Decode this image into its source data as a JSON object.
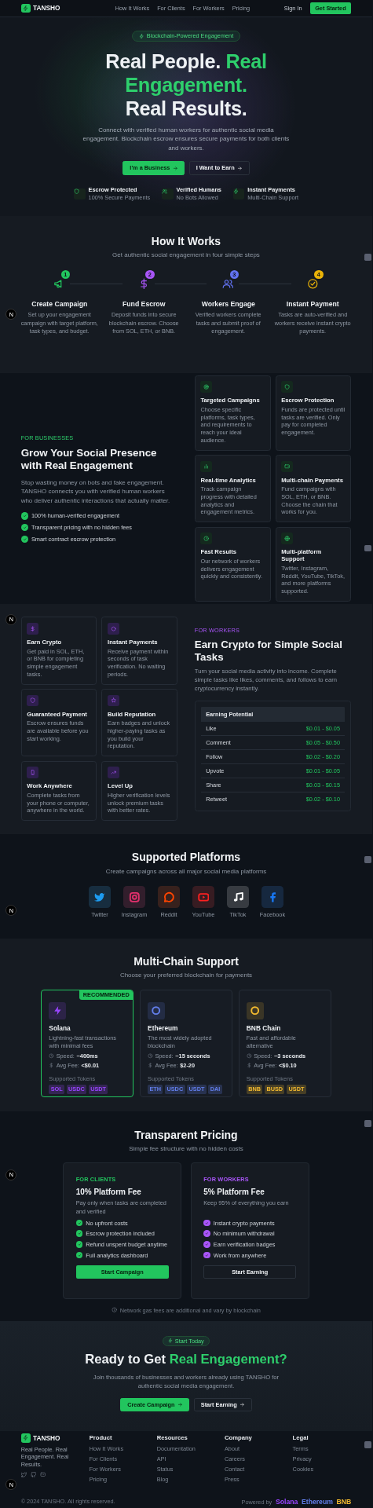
{
  "nav": {
    "logo": "TANSHO",
    "links": [
      "How It Works",
      "For Clients",
      "For Workers",
      "Pricing"
    ],
    "sign_in": "Sign In",
    "cta": "Get Started"
  },
  "hero": {
    "badge": "Blockchain-Powered Engagement",
    "title": [
      {
        "text": "Real People.",
        "accent": false
      },
      {
        "text": "Real Engagement.",
        "accent": true
      },
      {
        "text": "Real Results.",
        "accent": false
      }
    ],
    "subtitle": "Connect with verified human workers for authentic social media engagement. Blockchain escrow ensures secure payments for both clients and workers.",
    "buttons": [
      {
        "label": "I'm a Business",
        "kind": "primary"
      },
      {
        "label": "I Want to Earn",
        "kind": "outline"
      }
    ],
    "features": [
      {
        "title": "Escrow Protected",
        "subtitle": "100% Secure Payments"
      },
      {
        "title": "Verified Humans",
        "subtitle": "No Bots Allowed"
      },
      {
        "title": "Instant Payments",
        "subtitle": "Multi-Chain Support"
      }
    ]
  },
  "how_it_works": {
    "title": "How It Works",
    "subtitle": "Get authentic social engagement in four simple steps",
    "steps": [
      {
        "number": "1",
        "title": "Create Campaign",
        "text": "Set up your engagement campaign with target platform, task types, and budget.",
        "color": "#22c55e"
      },
      {
        "number": "2",
        "title": "Fund Escrow",
        "text": "Deposit funds into secure blockchain escrow. Choose from SOL, ETH, or BNB.",
        "color": "#a855f7"
      },
      {
        "number": "3",
        "title": "Workers Engage",
        "text": "Verified workers complete tasks and submit proof of engagement.",
        "color": "#6272f0"
      },
      {
        "number": "4",
        "title": "Instant Payment",
        "text": "Tasks are auto-verified and workers receive instant crypto payments.",
        "color": "#eab308"
      }
    ]
  },
  "for_businesses": {
    "eyebrow": "FOR BUSINESSES",
    "title": "Grow Your Social Presence with Real Engagement",
    "text": "Stop wasting money on bots and fake engagement. TANSHO connects you with verified human workers who deliver authentic interactions that actually matter.",
    "checks": [
      "100% human-verified engagement",
      "Transparent pricing with no hidden fees",
      "Smart contract escrow protection"
    ],
    "cards": [
      {
        "title": "Targeted Campaigns",
        "text": "Choose specific platforms, task types, and requirements to reach your ideal audience."
      },
      {
        "title": "Escrow Protection",
        "text": "Funds are protected until tasks are verified. Only pay for completed engagement."
      },
      {
        "title": "Real-time Analytics",
        "text": "Track campaign progress with detailed analytics and engagement metrics."
      },
      {
        "title": "Multi-chain Payments",
        "text": "Fund campaigns with SOL, ETH, or BNB. Choose the chain that works for you."
      },
      {
        "title": "Fast Results",
        "text": "Our network of workers delivers engagement quickly and consistently."
      },
      {
        "title": "Multi-platform Support",
        "text": "Twitter, Instagram, Reddit, YouTube, TikTok, and more platforms supported."
      }
    ]
  },
  "for_workers": {
    "eyebrow": "FOR WORKERS",
    "title": "Earn Crypto for Simple Social Tasks",
    "text": "Turn your social media activity into income. Complete simple tasks like likes, comments, and follows to earn cryptocurrency instantly.",
    "cards": [
      {
        "title": "Earn Crypto",
        "text": "Get paid in SOL, ETH, or BNB for completing simple engagement tasks."
      },
      {
        "title": "Instant Payments",
        "text": "Receive payment within seconds of task verification. No waiting periods."
      },
      {
        "title": "Guaranteed Payment",
        "text": "Escrow ensures funds are available before you start working."
      },
      {
        "title": "Build Reputation",
        "text": "Earn badges and unlock higher-paying tasks as you build your reputation."
      },
      {
        "title": "Work Anywhere",
        "text": "Complete tasks from your phone or computer, anywhere in the world."
      },
      {
        "title": "Level Up",
        "text": "Higher verification levels unlock premium tasks with better rates."
      }
    ],
    "table": {
      "title": "Earning Potential",
      "rows": [
        {
          "task": "Like",
          "range": "$0.01 - $0.05"
        },
        {
          "task": "Comment",
          "range": "$0.05 - $0.50"
        },
        {
          "task": "Follow",
          "range": "$0.02 - $0.20"
        },
        {
          "task": "Upvote",
          "range": "$0.01 - $0.05"
        },
        {
          "task": "Share",
          "range": "$0.03 - $0.15"
        },
        {
          "task": "Retweet",
          "range": "$0.02 - $0.10"
        }
      ]
    }
  },
  "platforms": {
    "title": "Supported Platforms",
    "subtitle": "Create campaigns across all major social media platforms",
    "items": [
      {
        "name": "Twitter",
        "color": "#1d9bf0"
      },
      {
        "name": "Instagram",
        "color": "#e1306c"
      },
      {
        "name": "Reddit",
        "color": "#ff4500"
      },
      {
        "name": "YouTube",
        "color": "#ff2020"
      },
      {
        "name": "TikTok",
        "color": "#ffffff"
      },
      {
        "name": "Facebook",
        "color": "#1877f2"
      }
    ]
  },
  "chains": {
    "title": "Multi-Chain Support",
    "subtitle": "Choose your preferred blockchain for payments",
    "items": [
      {
        "name": "Solana",
        "description": "Lightning-fast transactions with minimal fees",
        "speed_label": "Speed:",
        "speed": "~400ms",
        "fee_label": "Avg Fee:",
        "fee": "<$0.01",
        "tokens_label": "Supported Tokens",
        "tokens": [
          "SOL",
          "USDC",
          "USDT"
        ],
        "color": "#9945ff",
        "recommended": true,
        "badge": "RECOMMENDED"
      },
      {
        "name": "Ethereum",
        "description": "The most widely adopted blockchain",
        "speed_label": "Speed:",
        "speed": "~15 seconds",
        "fee_label": "Avg Fee:",
        "fee": "$2-20",
        "tokens_label": "Supported Tokens",
        "tokens": [
          "ETH",
          "USDC",
          "USDT",
          "DAI"
        ],
        "color": "#627eea",
        "recommended": false
      },
      {
        "name": "BNB Chain",
        "description": "Fast and affordable alternative",
        "speed_label": "Speed:",
        "speed": "~3 seconds",
        "fee_label": "Avg Fee:",
        "fee": "<$0.10",
        "tokens_label": "Supported Tokens",
        "tokens": [
          "BNB",
          "BUSD",
          "USDT"
        ],
        "color": "#f3ba2f",
        "recommended": false
      }
    ]
  },
  "pricing": {
    "title": "Transparent Pricing",
    "subtitle": "Simple fee structure with no hidden costs",
    "plans": [
      {
        "kind": "client",
        "eyebrow": "FOR CLIENTS",
        "title": "10% Platform Fee",
        "text": "Pay only when tasks are completed and verified",
        "features": [
          "No upfront costs",
          "Escrow protection included",
          "Refund unspent budget anytime",
          "Full analytics dashboard"
        ],
        "button": "Start Campaign"
      },
      {
        "kind": "worker",
        "eyebrow": "FOR WORKERS",
        "title": "5% Platform Fee",
        "text": "Keep 95% of everything you earn",
        "features": [
          "Instant crypto payments",
          "No minimum withdrawal",
          "Earn verification badges",
          "Work from anywhere"
        ],
        "button": "Start Earning"
      }
    ],
    "note": "Network gas fees are additional and vary by blockchain"
  },
  "cta": {
    "badge": "Start Today",
    "title": [
      {
        "text": "Ready to Get",
        "accent": false
      },
      {
        "text": "Real Engagement?",
        "accent": true
      }
    ],
    "text": "Join thousands of businesses and workers already using TANSHO for authentic social media engagement.",
    "buttons": [
      {
        "label": "Create Campaign",
        "kind": "primary"
      },
      {
        "label": "Start Earning",
        "kind": "outline"
      }
    ]
  },
  "footer": {
    "logo": "TANSHO",
    "tagline": "Real People. Real Engagement. Real Results.",
    "columns": [
      {
        "title": "Product",
        "links": [
          "How It Works",
          "For Clients",
          "For Workers",
          "Pricing"
        ]
      },
      {
        "title": "Resources",
        "links": [
          "Documentation",
          "API",
          "Status",
          "Blog"
        ]
      },
      {
        "title": "Company",
        "links": [
          "About",
          "Careers",
          "Contact",
          "Press"
        ]
      },
      {
        "title": "Legal",
        "links": [
          "Terms",
          "Privacy",
          "Cookies"
        ]
      }
    ],
    "copyright": "© 2024 TANSHO. All rights reserved.",
    "powered_by": "Powered by",
    "chains": [
      {
        "name": "Solana",
        "color": "#9945ff"
      },
      {
        "name": "Ethereum",
        "color": "#627eea"
      },
      {
        "name": "BNB",
        "color": "#f3ba2f"
      }
    ]
  },
  "overlay_badges": [
    "N",
    "N",
    "N",
    "N",
    "N"
  ]
}
